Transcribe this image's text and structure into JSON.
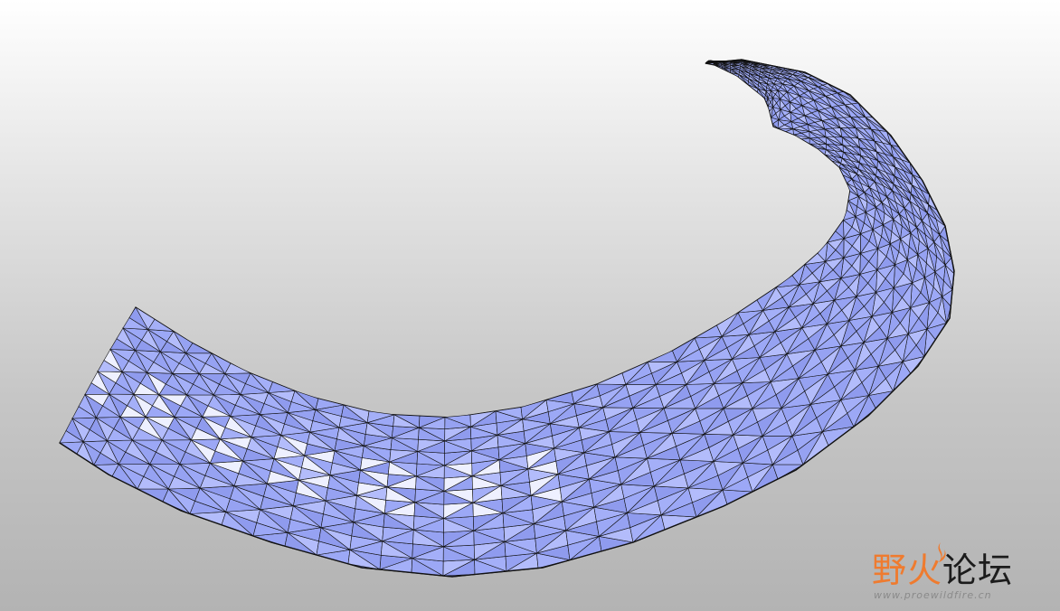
{
  "scene": {
    "mesh_fill": "#9aa6f4",
    "mesh_highlight": "#c9d0ff",
    "mesh_shadow": "#6f7bd8",
    "edge_color": "#111111",
    "background_top": "#ffffff",
    "background_bottom": "#b3b3b3"
  },
  "watermark": {
    "brand_accent": "野火",
    "brand_rest": "论坛",
    "url": "www.proewildfire.cn",
    "accent_color": "#ef7b2f",
    "icon": "flame-icon"
  }
}
